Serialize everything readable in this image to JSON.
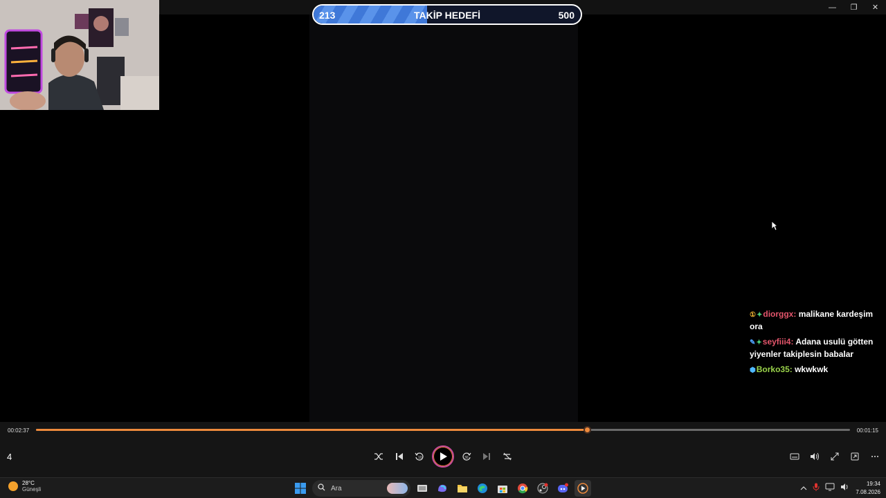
{
  "goal": {
    "title": "TAKİP HEDEFİ",
    "current": "213",
    "target": "500",
    "progress": 0.426
  },
  "chat": [
    {
      "badges": [
        "①",
        "✦"
      ],
      "user": "diorggx:",
      "user_color": "#e5566c",
      "text": "malikane kardeşim ora"
    },
    {
      "badges": [
        "✎",
        "✦"
      ],
      "user": "seyfiii4:",
      "user_color": "#e5566c",
      "text": "Adana usulü götten yiyenler takiplesin babalar"
    },
    {
      "badges": [
        "⬢"
      ],
      "user": "Borko35:",
      "user_color": "#9ad34a",
      "text": "wkwkwk"
    }
  ],
  "player": {
    "elapsed": "00:02:37",
    "remaining": "00:01:15",
    "progress": 0.677,
    "speed_label": "4",
    "accent": "#ee8a3c"
  },
  "taskbar": {
    "weather_temp": "28°C",
    "weather_desc": "Güneşli",
    "search_placeholder": "Ara",
    "time": "19:34",
    "date": "7.08.2026"
  }
}
